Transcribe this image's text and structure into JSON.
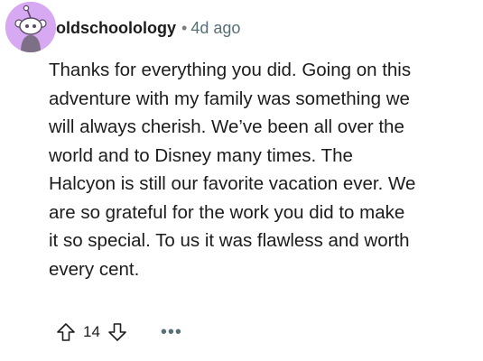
{
  "comment": {
    "username": "oldschoolology",
    "separator": "•",
    "timestamp": "4d ago",
    "body_lines": [
      "Thanks for everything you did. Going on this",
      "adventure with my family was something we",
      "will always cherish. We’ve been all over the",
      "world and to Disney many times. The",
      "Halcyon is still our favorite vacation ever. We",
      "are so grateful for the work you did to make",
      "it so special. To us it was flawless and worth",
      "every cent."
    ],
    "score": "14",
    "more_label": "•••"
  },
  "icons": {
    "avatar": "snoo-avatar-icon",
    "upvote": "upvote-arrow-icon",
    "downvote": "downvote-arrow-icon",
    "more": "ellipsis-icon"
  },
  "colors": {
    "avatar_bg": "#d7a9f2",
    "text": "#1c1c1c",
    "meta": "#576f76"
  }
}
